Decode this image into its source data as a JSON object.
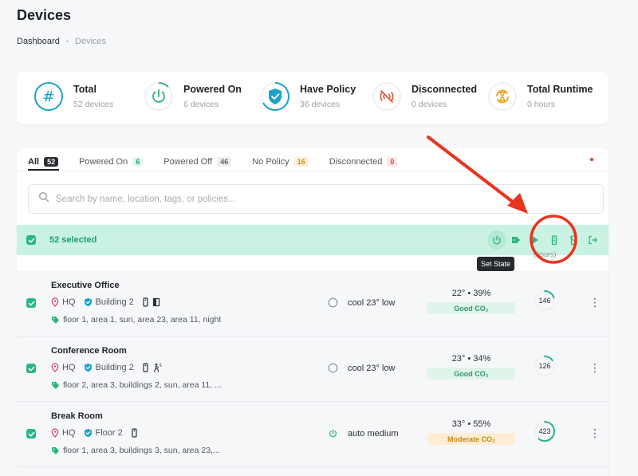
{
  "page": {
    "title": "Devices"
  },
  "breadcrumb": {
    "home": "Dashboard",
    "separator": "•",
    "current": "Devices"
  },
  "stats": [
    {
      "label": "Total",
      "sub": "52 devices",
      "icon": "hash-icon",
      "color": "#1aa3c6"
    },
    {
      "label": "Powered On",
      "sub": "6 devices",
      "icon": "power-icon",
      "color": "#2fb37a",
      "progress": 0.12
    },
    {
      "label": "Have Policy",
      "sub": "36 devices",
      "icon": "shield-check-icon",
      "color": "#1aa3c6",
      "progress": 0.69
    },
    {
      "label": "Disconnected",
      "sub": "0 devices",
      "icon": "wifi-off-icon",
      "color": "#e25b3c"
    },
    {
      "label": "Total Runtime",
      "sub": "0 hours",
      "icon": "hourglass-refresh-icon",
      "color": "#e6a21a"
    }
  ],
  "tabs": [
    {
      "label": "All",
      "count": "52",
      "active": true
    },
    {
      "label": "Powered On",
      "count": "6"
    },
    {
      "label": "Powered Off",
      "count": "46"
    },
    {
      "label": "No Policy",
      "count": "16"
    },
    {
      "label": "Disconnected",
      "count": "0"
    }
  ],
  "search": {
    "placeholder": "Search by name, location, tags, or policies..."
  },
  "bulk": {
    "selected_text": "52 selected",
    "tooltip": "Set State",
    "faint_header": "(hours)"
  },
  "devices": [
    {
      "name": "Executive Office",
      "location": "HQ",
      "group": "Building 2",
      "tags": "floor 1, area 1, sun, area 23, area 11, night",
      "state": "cool 23° low",
      "state_on": false,
      "env": "22° • 39%",
      "co2": "Good CO₂",
      "co2_level": "good",
      "runtime": "146",
      "runtime_progress": 0.2
    },
    {
      "name": "Conference Room",
      "location": "HQ",
      "group": "Building 2",
      "tags": "floor 2, area 3, buildings 2, sun, area 11, ...",
      "state": "cool 23° low",
      "state_on": false,
      "env": "23° • 34%",
      "co2": "Good CO₂",
      "co2_level": "good",
      "runtime": "126",
      "runtime_progress": 0.15
    },
    {
      "name": "Break Room",
      "location": "HQ",
      "group": "Floor 2",
      "tags": "floor 1, area 3, buildings 3, sun, area 23,...",
      "state": "auto medium",
      "state_on": true,
      "env": "33° • 55%",
      "co2": "Moderate CO₂",
      "co2_level": "moderate",
      "runtime": "423",
      "runtime_progress": 0.6
    }
  ],
  "colors": {
    "accent": "#29b68a",
    "annotation": "#e8341f"
  }
}
